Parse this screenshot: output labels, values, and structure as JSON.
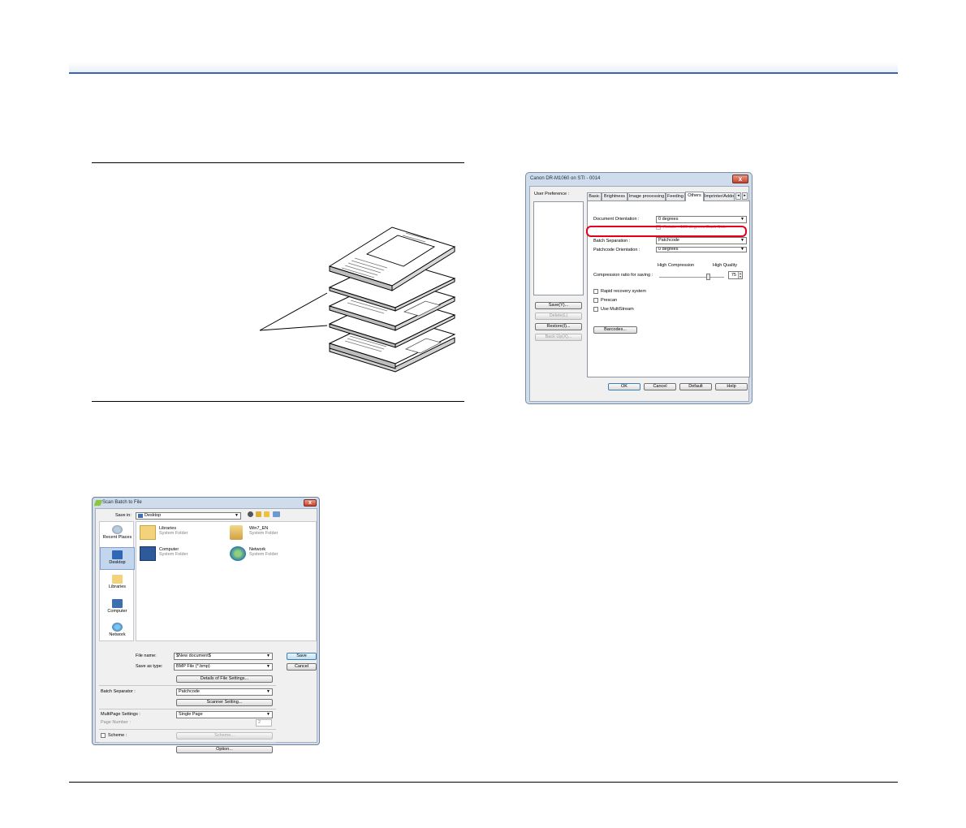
{
  "canon_dialog": {
    "title": "Canon DR-M1060 on STI - 0014",
    "close_glyph": "x",
    "user_preference_label": "User Preference :",
    "side_buttons": [
      "Save(Y)...",
      "Delete(L)",
      "Restore(I)...",
      "Back Up(X)..."
    ],
    "tabs": [
      "Basic",
      "Brightness",
      "Image processing",
      "Feeding",
      "Others",
      "Imprinter/Addo"
    ],
    "tab_scroll_left": "◂",
    "tab_scroll_right": "▸",
    "active_tab": "Others",
    "document_orientation_label": "Document Orientation :",
    "document_orientation_value": "0 degrees",
    "rotate_back_side_label": "Rotate +180 degrees Back Side",
    "batch_separation_label": "Batch Separation :",
    "batch_separation_value": "Patchcode",
    "patchcode_orientation_label": "Patchcode Orientation :",
    "patchcode_orientation_value": "0 degrees",
    "high_compression_label": "High Compression",
    "high_quality_label": "High Quality",
    "compression_label": "Compression ratio for saving :",
    "compression_value": "75",
    "compression_level": 0.75,
    "checkboxes": [
      "Rapid recovery system",
      "Prescan",
      "Use MultiStream"
    ],
    "barcodes_button": "Barcodes...",
    "bottom_buttons": [
      "OK",
      "Cancel",
      "Default",
      "Help"
    ],
    "highlight_color": "#e2001a"
  },
  "scan_dialog": {
    "title": "Scan Batch to File",
    "close_glyph": "x",
    "save_in_label": "Save in:",
    "save_in_value": "Desktop",
    "places": [
      "Recent Places",
      "Desktop",
      "Libraries",
      "Computer",
      "Network"
    ],
    "selected_place": "Desktop",
    "files": [
      {
        "name": "Libraries",
        "type": "System Folder"
      },
      {
        "name": "Win7_EN",
        "type": "System Folder"
      },
      {
        "name": "Computer",
        "type": "System Folder"
      },
      {
        "name": "Network",
        "type": "System Folder"
      }
    ],
    "file_name_label": "File name:",
    "file_name_value": "$New document$",
    "save_as_type_label": "Save as type:",
    "save_as_type_value": "BMP File (*.bmp)",
    "save_button": "Save",
    "cancel_button": "Cancel",
    "details_button": "Details of File Settings...",
    "batch_separator_label": "Batch Separator :",
    "batch_separator_value": "Patchcode",
    "scanner_setting_button": "Scanner Setting...",
    "multipage_label": "MultiPage Settings :",
    "multipage_value": "Single Page",
    "page_number_label": "Page Number :",
    "page_number_value": "2",
    "scheme_label": "Scheme :",
    "scheme_button": "Scheme...",
    "option_button": "Option..."
  },
  "colors": {
    "header_accent": "#3a62b5"
  }
}
